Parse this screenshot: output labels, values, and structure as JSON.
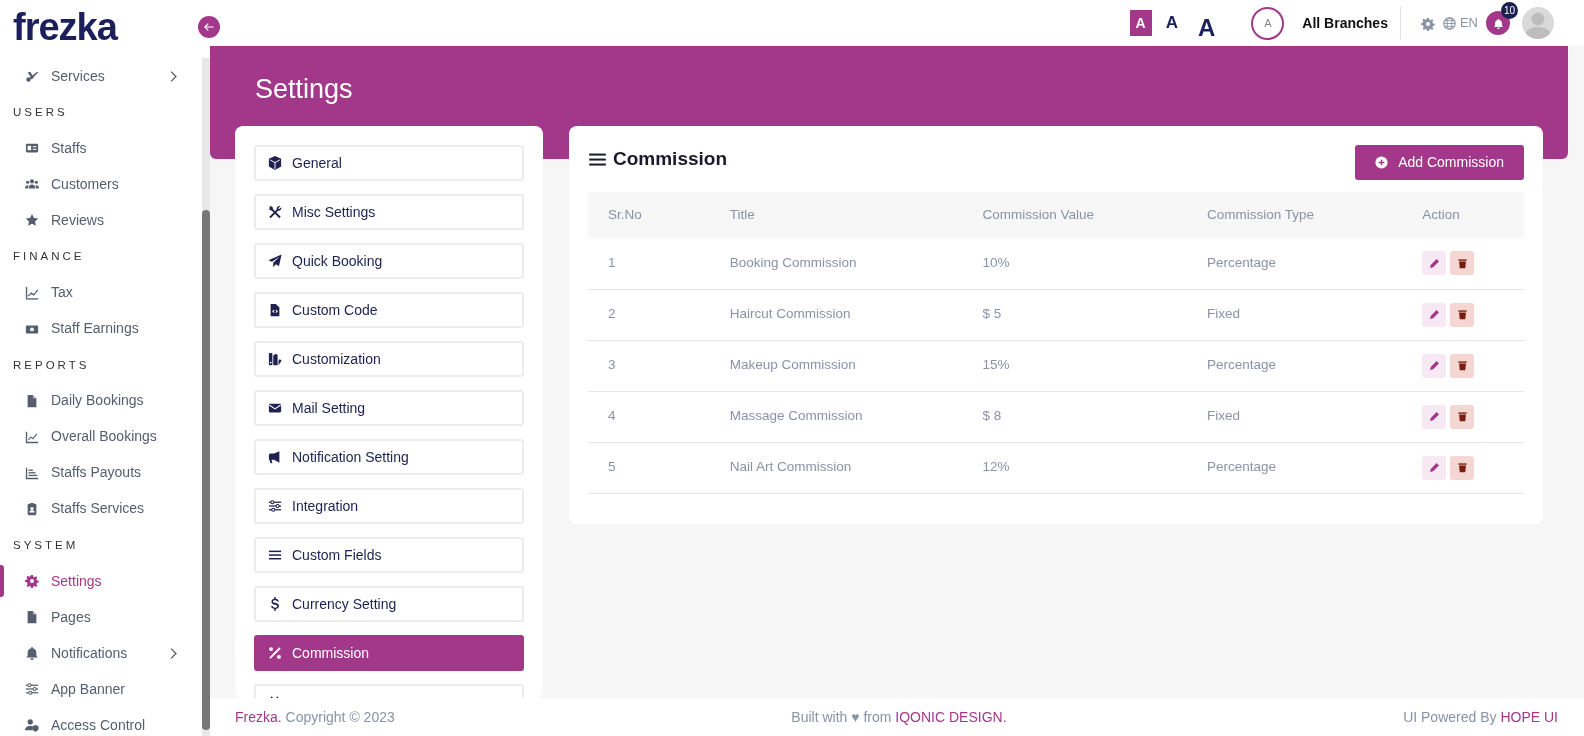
{
  "logo": "frezka",
  "sidebar": [
    {
      "kind": "item",
      "label": "Services",
      "selected": false,
      "expandable": true
    },
    {
      "kind": "heading",
      "label": "USERS"
    },
    {
      "kind": "item",
      "label": "Staffs",
      "selected": false,
      "expandable": false
    },
    {
      "kind": "item",
      "label": "Customers",
      "selected": false,
      "expandable": false
    },
    {
      "kind": "item",
      "label": "Reviews",
      "selected": false,
      "expandable": false
    },
    {
      "kind": "heading",
      "label": "FINANCE"
    },
    {
      "kind": "item",
      "label": "Tax",
      "selected": false,
      "expandable": false
    },
    {
      "kind": "item",
      "label": "Staff Earnings",
      "selected": false,
      "expandable": false
    },
    {
      "kind": "heading",
      "label": "REPORTS"
    },
    {
      "kind": "item",
      "label": "Daily Bookings",
      "selected": false,
      "expandable": false
    },
    {
      "kind": "item",
      "label": "Overall Bookings",
      "selected": false,
      "expandable": false
    },
    {
      "kind": "item",
      "label": "Staffs Payouts",
      "selected": false,
      "expandable": false
    },
    {
      "kind": "item",
      "label": "Staffs Services",
      "selected": false,
      "expandable": false
    },
    {
      "kind": "heading",
      "label": "SYSTEM"
    },
    {
      "kind": "item",
      "label": "Settings",
      "selected": true,
      "expandable": false
    },
    {
      "kind": "item",
      "label": "Pages",
      "selected": false,
      "expandable": false
    },
    {
      "kind": "item",
      "label": "Notifications",
      "selected": false,
      "expandable": true
    },
    {
      "kind": "item",
      "label": "App Banner",
      "selected": false,
      "expandable": false
    },
    {
      "kind": "item",
      "label": "Access Control",
      "selected": false,
      "expandable": false
    }
  ],
  "header": {
    "font_sizes": [
      {
        "label": "A",
        "selected": true
      },
      {
        "label": "A",
        "selected": false
      },
      {
        "label": "A",
        "selected": false
      }
    ],
    "branch_initial": "A",
    "branch": "All Branches",
    "language": "EN",
    "notification_count": "10"
  },
  "page_title": "Settings",
  "settings_menu": [
    {
      "label": "General",
      "selected": false
    },
    {
      "label": "Misc Settings",
      "selected": false
    },
    {
      "label": "Quick Booking",
      "selected": false
    },
    {
      "label": "Custom Code",
      "selected": false
    },
    {
      "label": "Customization",
      "selected": false
    },
    {
      "label": "Mail Setting",
      "selected": false
    },
    {
      "label": "Notification Setting",
      "selected": false
    },
    {
      "label": "Integration",
      "selected": false
    },
    {
      "label": "Custom Fields",
      "selected": false
    },
    {
      "label": "Currency Setting",
      "selected": false
    },
    {
      "label": "Commission",
      "selected": true
    }
  ],
  "panel": {
    "title": "Commission",
    "add_button": "Add Commission",
    "columns": [
      "Sr.No",
      "Title",
      "Commission Value",
      "Commission Type",
      "Action"
    ],
    "rows": [
      {
        "sr": "1",
        "title": "Booking Commission",
        "value": "10%",
        "type": "Percentage"
      },
      {
        "sr": "2",
        "title": "Haircut Commission",
        "value": "$ 5",
        "type": "Fixed"
      },
      {
        "sr": "3",
        "title": "Makeup Commission",
        "value": "15%",
        "type": "Percentage"
      },
      {
        "sr": "4",
        "title": "Massage Commission",
        "value": "$ 8",
        "type": "Fixed"
      },
      {
        "sr": "5",
        "title": "Nail Art Commission",
        "value": "12%",
        "type": "Percentage"
      }
    ]
  },
  "footer": {
    "brand": "Frezka.",
    "copyright": " Copyright © 2023",
    "built_with": "Built with ♥ from ",
    "credit": "IQONIC DESIGN.",
    "powered_by": "UI Powered By ",
    "theme": "HOPE UI"
  }
}
